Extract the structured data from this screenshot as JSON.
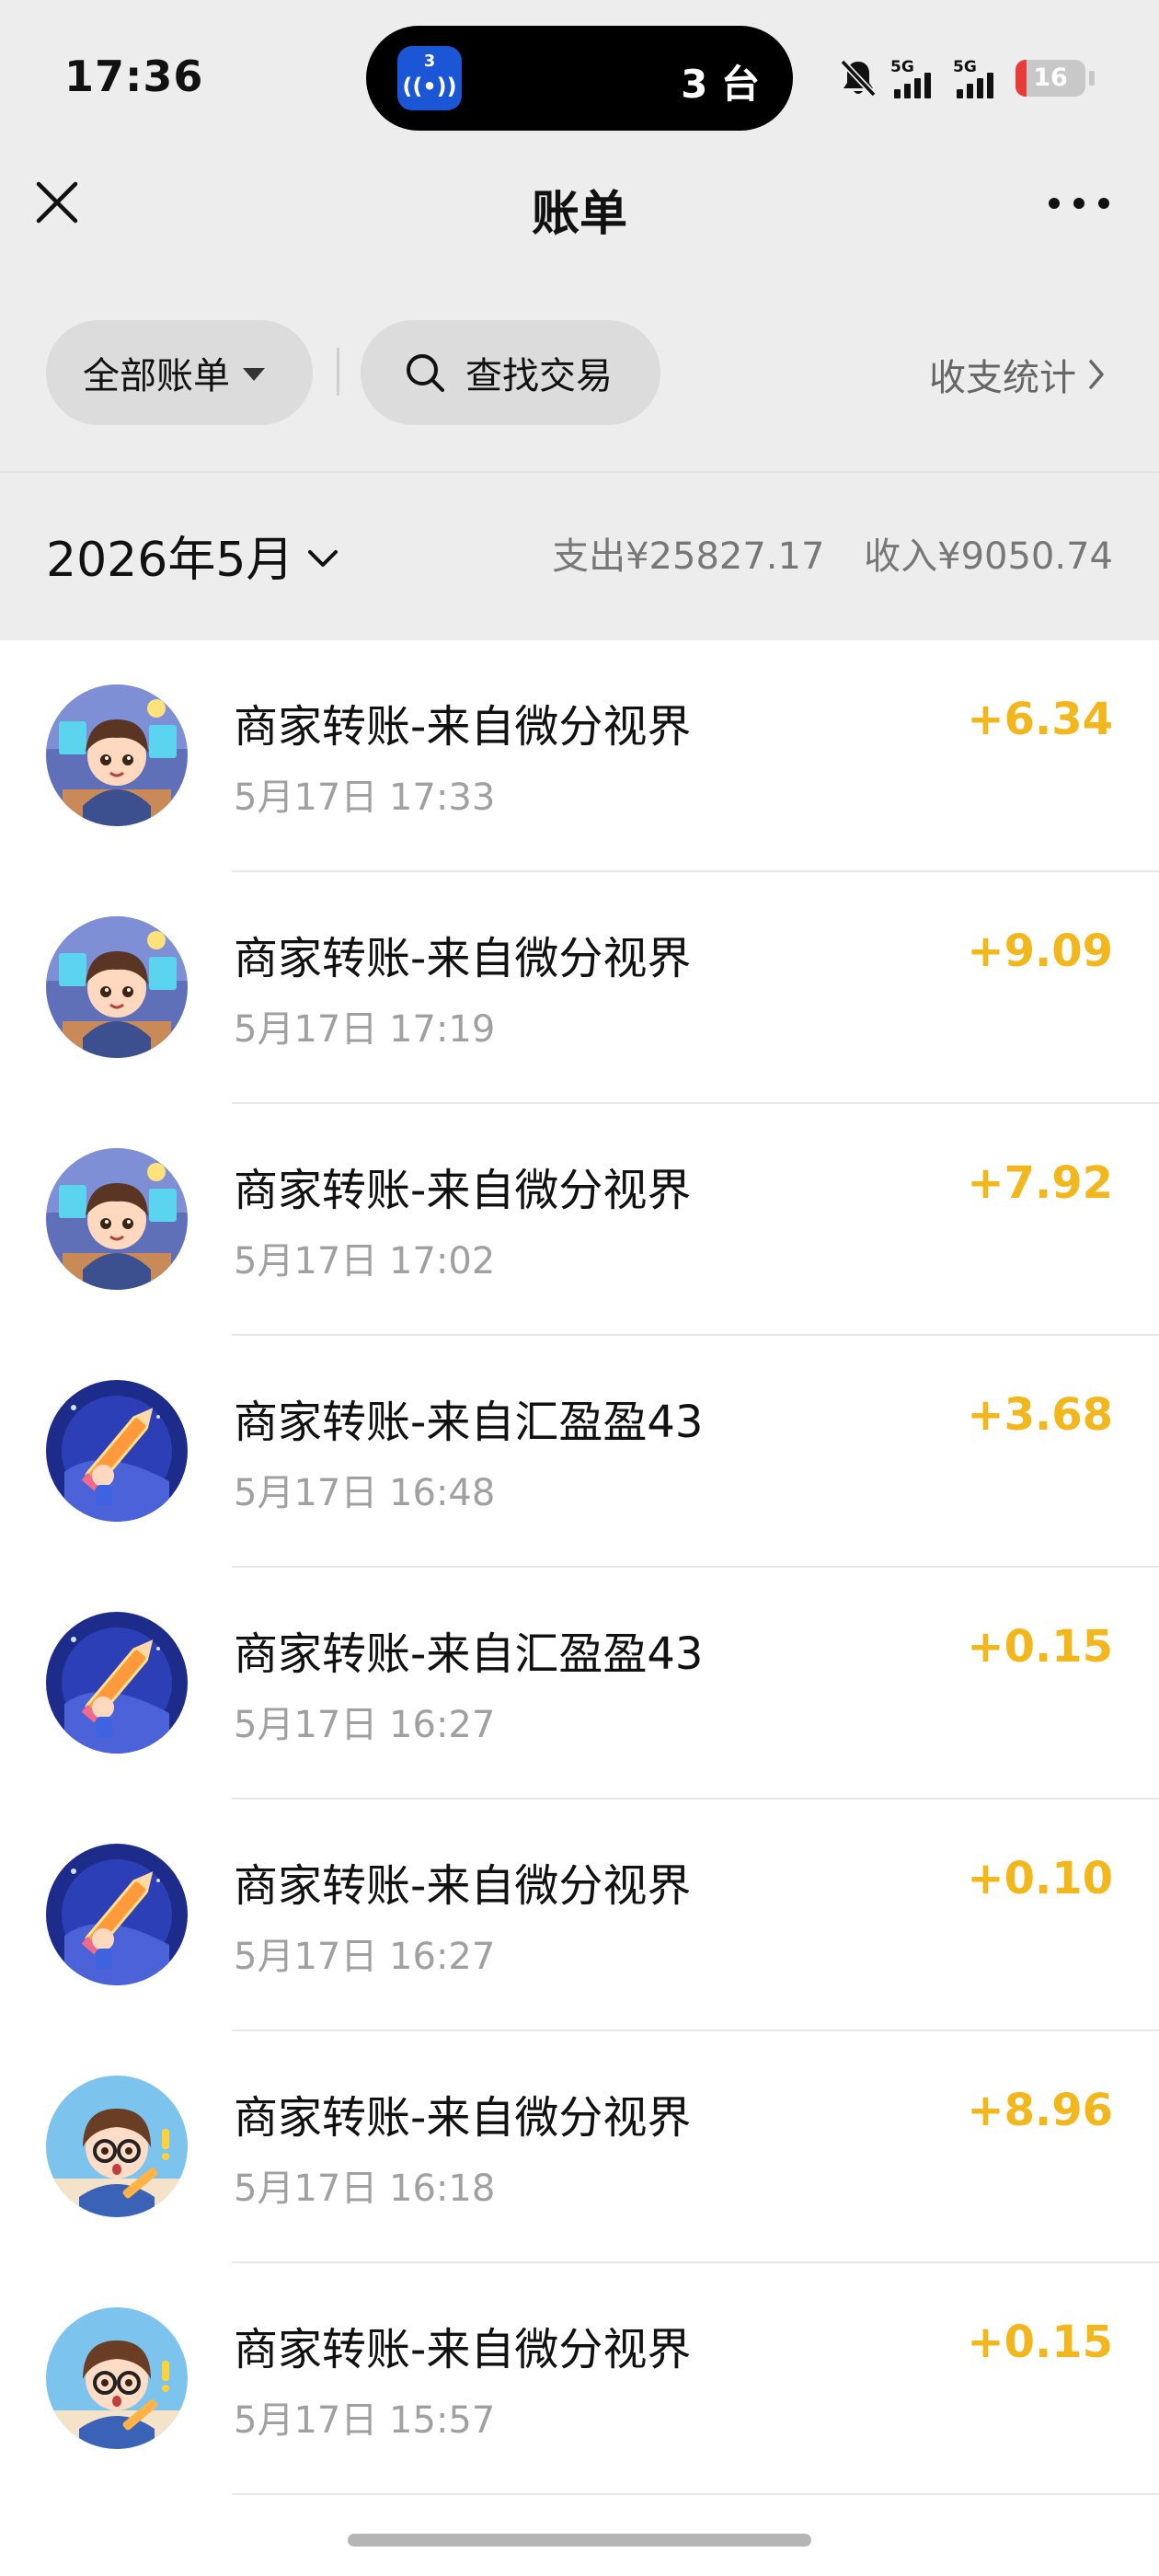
{
  "status_bar": {
    "time": "17:36",
    "island_app_badge": "3",
    "island_app_icon": "((•))",
    "island_text": "3 台",
    "signal_1_label": "5G",
    "signal_2_label": "5G",
    "battery_level": "16",
    "battery_color": "#ea3b3b"
  },
  "nav": {
    "title": "账单"
  },
  "filters": {
    "all_bills_label": "全部账单",
    "search_label": "查找交易",
    "stats_label": "收支统计"
  },
  "month": {
    "label": "2026年5月",
    "expense": "支出¥25827.17",
    "income": "收入¥9050.74"
  },
  "colors": {
    "income_amount": "#f2b71c"
  },
  "transactions": [
    {
      "title": "商家转账-来自微分视界",
      "time": "5月17日 17:33",
      "amount": "+6.34",
      "avatar": "boy-avatar"
    },
    {
      "title": "商家转账-来自微分视界",
      "time": "5月17日 17:19",
      "amount": "+9.09",
      "avatar": "boy-avatar"
    },
    {
      "title": "商家转账-来自微分视界",
      "time": "5月17日 17:02",
      "amount": "+7.92",
      "avatar": "boy-avatar"
    },
    {
      "title": "商家转账-来自汇盈盈43",
      "time": "5月17日 16:48",
      "amount": "+3.68",
      "avatar": "pencil-avatar"
    },
    {
      "title": "商家转账-来自汇盈盈43",
      "time": "5月17日 16:27",
      "amount": "+0.15",
      "avatar": "pencil-avatar"
    },
    {
      "title": "商家转账-来自微分视界",
      "time": "5月17日 16:27",
      "amount": "+0.10",
      "avatar": "pencil-avatar"
    },
    {
      "title": "商家转账-来自微分视界",
      "time": "5月17日 16:18",
      "amount": "+8.96",
      "avatar": "girl-avatar"
    },
    {
      "title": "商家转账-来自微分视界",
      "time": "5月17日 15:57",
      "amount": "+0.15",
      "avatar": "girl-avatar"
    }
  ]
}
